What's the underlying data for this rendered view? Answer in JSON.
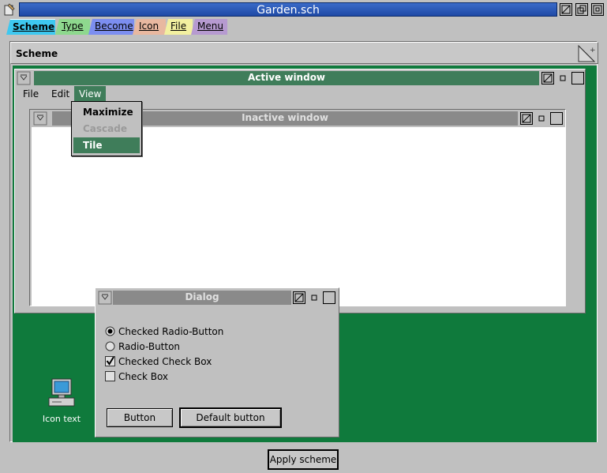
{
  "window": {
    "title": "Garden.sch"
  },
  "tabs": [
    {
      "label": "Scheme",
      "selected": true,
      "color": "#3ec8f0"
    },
    {
      "label": "Type",
      "color": "#8ed88e"
    },
    {
      "label": "Become",
      "color": "#7c8ef0"
    },
    {
      "label": "Icon",
      "color": "#e8b8a0"
    },
    {
      "label": "File",
      "color": "#f2f0a0"
    },
    {
      "label": "Menu",
      "color": "#b69ad0"
    }
  ],
  "scheme_panel": {
    "label": "Scheme",
    "desktop_color": "#0f7a3c"
  },
  "active_window": {
    "title": "Active window",
    "title_color": "#3f7d5a",
    "menubar": [
      "File",
      "Edit",
      "View"
    ]
  },
  "view_menu": {
    "items": [
      {
        "label": "Maximize",
        "enabled": true
      },
      {
        "label": "Cascade",
        "enabled": false
      },
      {
        "label": "Tile",
        "enabled": true,
        "highlighted": true
      }
    ]
  },
  "inactive_window": {
    "title": "Inactive window"
  },
  "dialog": {
    "title": "Dialog",
    "options": [
      {
        "label": "Checked Radio-Button",
        "type": "radio",
        "checked": true
      },
      {
        "label": "Radio-Button",
        "type": "radio",
        "checked": false
      },
      {
        "label": "Checked Check Box",
        "type": "checkbox",
        "checked": true
      },
      {
        "label": "Check Box",
        "type": "checkbox",
        "checked": false
      }
    ],
    "button_label": "Button",
    "default_button_label": "Default button"
  },
  "desktop_icon": {
    "label": "Icon text",
    "icon": "computer-icon"
  },
  "apply_button_label": "Apply scheme"
}
